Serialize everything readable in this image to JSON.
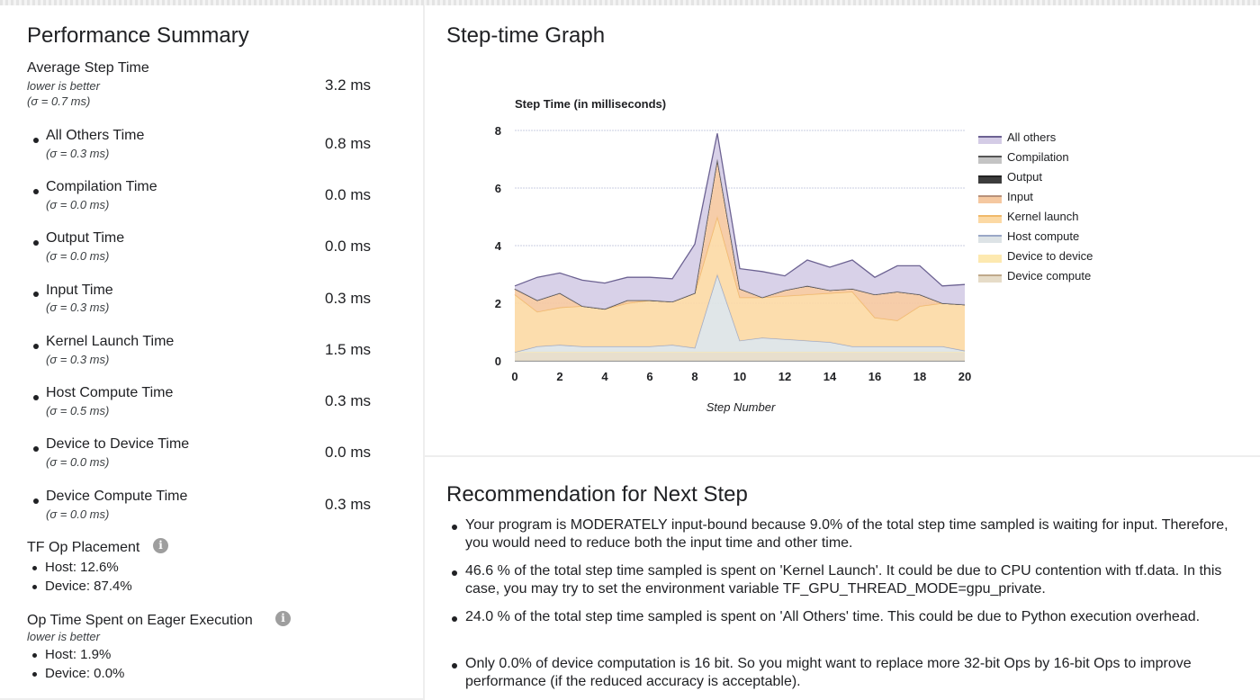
{
  "summary": {
    "title": "Performance Summary",
    "avg": {
      "label": "Average Step Time",
      "note": "lower is better",
      "sigma": "(σ = 0.7 ms)",
      "value": "3.2 ms"
    },
    "items": [
      {
        "label": "All Others Time",
        "sigma": "(σ = 0.3 ms)",
        "value": "0.8 ms"
      },
      {
        "label": "Compilation Time",
        "sigma": "(σ = 0.0 ms)",
        "value": "0.0 ms"
      },
      {
        "label": "Output Time",
        "sigma": "(σ = 0.0 ms)",
        "value": "0.0 ms"
      },
      {
        "label": "Input Time",
        "sigma": "(σ = 0.3 ms)",
        "value": "0.3 ms"
      },
      {
        "label": "Kernel Launch Time",
        "sigma": "(σ = 0.3 ms)",
        "value": "1.5 ms"
      },
      {
        "label": "Host Compute Time",
        "sigma": "(σ = 0.5 ms)",
        "value": "0.3 ms"
      },
      {
        "label": "Device to Device Time",
        "sigma": "(σ = 0.0 ms)",
        "value": "0.0 ms"
      },
      {
        "label": "Device Compute Time",
        "sigma": "(σ = 0.0 ms)",
        "value": "0.3 ms"
      }
    ],
    "placement": {
      "title": "TF Op Placement",
      "host": "Host: 12.6%",
      "device": "Device: 87.4%"
    },
    "eager": {
      "title": "Op Time Spent on Eager Execution",
      "note": "lower is better",
      "host": "Host: 1.9%",
      "device": "Device: 0.0%"
    },
    "info_icon_glyph": "i"
  },
  "graph": {
    "title": "Step-time Graph"
  },
  "chart_data": {
    "type": "area",
    "title": "Step Time (in milliseconds)",
    "xlabel": "Step Number",
    "ylabel": "",
    "xlim": [
      0,
      20
    ],
    "ylim": [
      0,
      8
    ],
    "x_ticks": [
      "0",
      "2",
      "4",
      "6",
      "8",
      "10",
      "12",
      "14",
      "16",
      "18",
      "20"
    ],
    "y_ticks": [
      "0",
      "2",
      "4",
      "6",
      "8"
    ],
    "grid": true,
    "stacked": true,
    "legend_position": "right",
    "x": [
      0,
      1,
      2,
      3,
      4,
      5,
      6,
      7,
      8,
      9,
      10,
      11,
      12,
      13,
      14,
      15,
      16,
      17,
      18,
      19,
      20
    ],
    "series": [
      {
        "name": "Device compute",
        "color": "#e6dcc8",
        "line": "#bfa98a",
        "values": [
          0.3,
          0.3,
          0.3,
          0.3,
          0.3,
          0.3,
          0.3,
          0.3,
          0.3,
          0.3,
          0.3,
          0.3,
          0.3,
          0.3,
          0.3,
          0.3,
          0.3,
          0.3,
          0.3,
          0.3,
          0.3
        ]
      },
      {
        "name": "Device to device",
        "color": "#fde9b0",
        "line": "#fde9b0",
        "values": [
          0,
          0,
          0,
          0,
          0,
          0,
          0,
          0,
          0,
          0,
          0,
          0,
          0,
          0,
          0,
          0,
          0,
          0,
          0,
          0,
          0
        ]
      },
      {
        "name": "Host compute",
        "color": "#dde3e6",
        "line": "#9aa7c7",
        "values": [
          0.0,
          0.2,
          0.25,
          0.2,
          0.2,
          0.2,
          0.2,
          0.25,
          0.15,
          2.7,
          0.4,
          0.5,
          0.45,
          0.4,
          0.35,
          0.2,
          0.2,
          0.2,
          0.2,
          0.2,
          0.05
        ]
      },
      {
        "name": "Kernel launch",
        "color": "#fcd9a4",
        "line": "#f0b96a",
        "values": [
          2.0,
          1.2,
          1.3,
          1.4,
          1.3,
          1.5,
          1.6,
          1.5,
          1.9,
          2.0,
          1.5,
          1.4,
          1.5,
          1.6,
          1.7,
          1.9,
          1.0,
          0.9,
          1.4,
          1.5,
          1.6
        ]
      },
      {
        "name": "Input",
        "color": "#f5c8a0",
        "line": "#b8917a",
        "values": [
          0.2,
          0.4,
          0.5,
          0.0,
          0.0,
          0.1,
          0.0,
          0.0,
          0.0,
          2.0,
          0.3,
          0.0,
          0.2,
          0.3,
          0.1,
          0.1,
          0.8,
          1.0,
          0.4,
          0.0,
          0.0
        ]
      },
      {
        "name": "Output",
        "color": "#3c3c3c",
        "line": "#222222",
        "values": [
          0,
          0,
          0,
          0,
          0,
          0,
          0,
          0,
          0,
          0,
          0,
          0,
          0,
          0,
          0,
          0,
          0,
          0,
          0,
          0,
          0
        ]
      },
      {
        "name": "Compilation",
        "color": "#c4c4c4",
        "line": "#555555",
        "values": [
          0,
          0,
          0,
          0,
          0,
          0,
          0,
          0,
          0,
          0,
          0,
          0,
          0,
          0,
          0,
          0,
          0,
          0,
          0,
          0,
          0
        ]
      },
      {
        "name": "All others",
        "color": "#d4cce6",
        "line": "#6c6292",
        "values": [
          0.1,
          0.8,
          0.7,
          0.9,
          0.9,
          0.8,
          0.8,
          0.8,
          1.7,
          0.9,
          0.7,
          0.9,
          0.5,
          0.9,
          0.8,
          1.0,
          0.6,
          0.9,
          1.0,
          0.6,
          0.7
        ]
      }
    ]
  },
  "recommendation": {
    "title": "Recommendation for Next Step",
    "items": [
      "Your program is MODERATELY input-bound because 9.0% of the total step time sampled is waiting for input. Therefore, you would need to reduce both the input time and other time.",
      "46.6 % of the total step time sampled is spent on 'Kernel Launch'. It could be due to CPU contention with tf.data. In this case, you may try to set the environment variable TF_GPU_THREAD_MODE=gpu_private.",
      "24.0 % of the total step time sampled is spent on 'All Others' time. This could be due to Python execution overhead.",
      "Only 0.0% of device computation is 16 bit. So you might want to replace more 32-bit Ops by 16-bit Ops to improve performance (if the reduced accuracy is acceptable)."
    ]
  }
}
